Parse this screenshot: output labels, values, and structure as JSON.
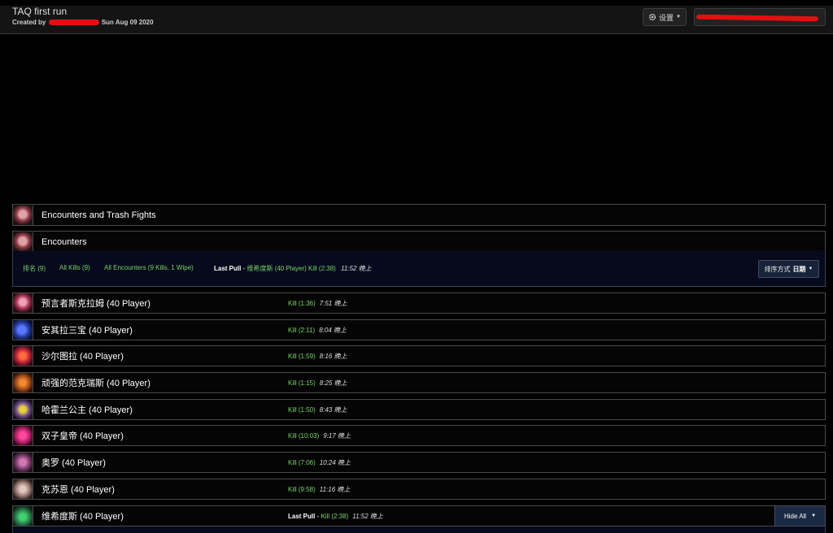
{
  "header": {
    "title": "TAQ first run",
    "created_by_label": "Created by",
    "date": "Sun Aug 09 2020",
    "settings_label": "设置"
  },
  "panels": {
    "all_fights": "Encounters and Trash Fights",
    "encounters": "Encounters"
  },
  "filters": {
    "rank": "排名 (9)",
    "all_kills": "All Kills (9)",
    "all_encounters": "All Encounters (9 Kills, 1 Wipe)",
    "last_pull_label": "Last Pull",
    "last_pull_text": "维希度斯 (40 Player) Kill (2:38)",
    "last_pull_time": "11:52 晚上",
    "sort_label": "排序方式",
    "sort_value": "日期"
  },
  "fights": [
    {
      "name": "预言者斯克拉姆 (40 Player)",
      "result": "Kill (1:36)",
      "time": "7:51 晚上"
    },
    {
      "name": "安其拉三宝 (40 Player)",
      "result": "Kill (2:11)",
      "time": "8:04 晚上"
    },
    {
      "name": "沙尔图拉 (40 Player)",
      "result": "Kill (1:59)",
      "time": "8:16 晚上"
    },
    {
      "name": "顽强的范克瑞斯 (40 Player)",
      "result": "Kill (1:15)",
      "time": "8:25 晚上"
    },
    {
      "name": "哈霍兰公主 (40 Player)",
      "result": "Kill (1:50)",
      "time": "8:43 晚上"
    },
    {
      "name": "双子皇帝 (40 Player)",
      "result": "Kill (10:03)",
      "time": "9:17 晚上"
    },
    {
      "name": "奥罗 (40 Player)",
      "result": "Kill (7:06)",
      "time": "10:24 晚上"
    },
    {
      "name": "克苏恩 (40 Player)",
      "result": "Kill (9:58)",
      "time": "11:16 晚上"
    },
    {
      "name": "维希度斯 (40 Player)",
      "last_pull_label": "Last Pull",
      "result": "Kill (2:38)",
      "time": "11:52 晚上",
      "hide_label": "Hide All"
    }
  ],
  "icons": {
    "settings": "gear-icon",
    "caret": "caret-down-icon",
    "boss": "boss-portrait-icon"
  },
  "colors": {
    "kill_green": "#79d36a",
    "filter_bg": "#060a1c",
    "button_blue": "#1b2a44"
  }
}
